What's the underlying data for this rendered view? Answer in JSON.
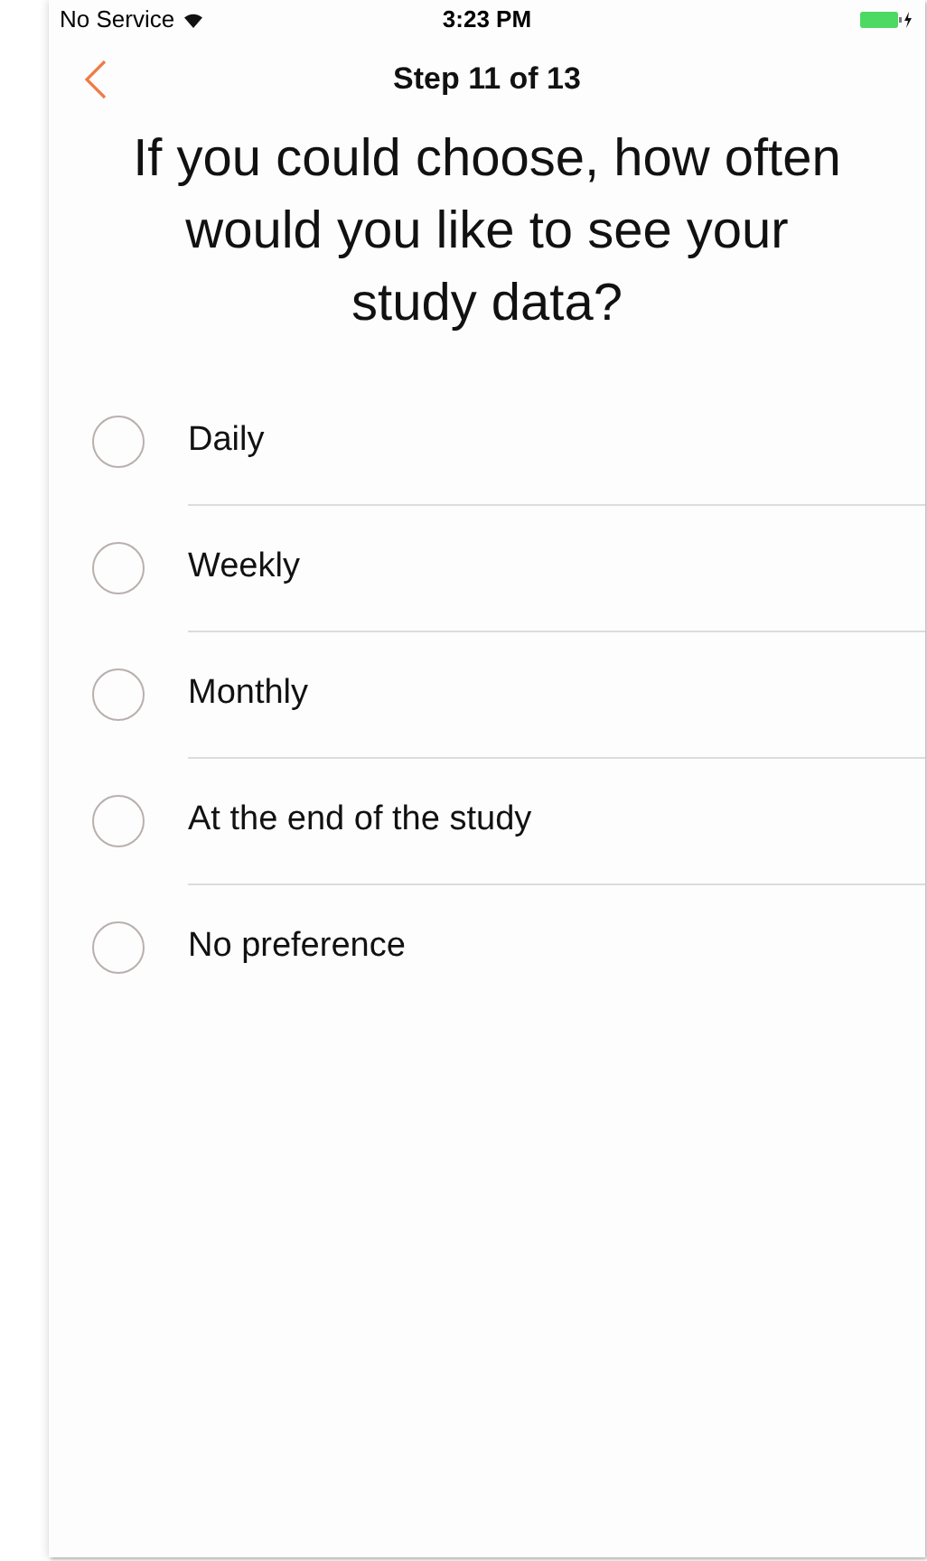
{
  "status_bar": {
    "carrier": "No Service",
    "time": "3:23 PM"
  },
  "nav": {
    "title": "Step 11 of 13"
  },
  "question": "If you could choose, how often would you like to see your study data?",
  "options": [
    {
      "label": "Daily",
      "selected": false
    },
    {
      "label": "Weekly",
      "selected": false
    },
    {
      "label": "Monthly",
      "selected": false
    },
    {
      "label": "At the end of the study",
      "selected": false
    },
    {
      "label": "No preference",
      "selected": false
    }
  ]
}
